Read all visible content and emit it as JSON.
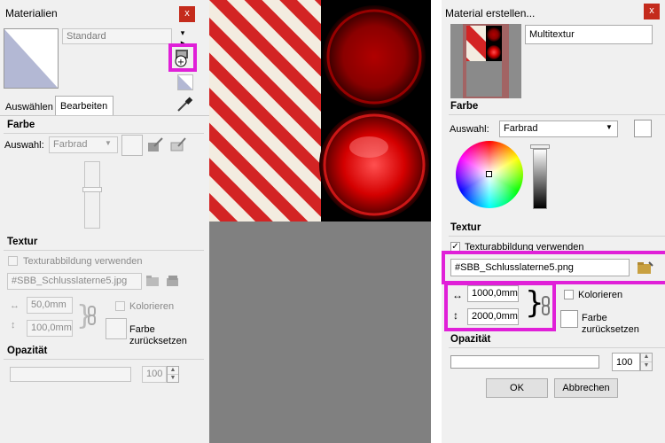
{
  "left_panel": {
    "title": "Materialien",
    "close": "x",
    "material_name": "Standard",
    "tabs": [
      "Auswählen",
      "Bearbeiten"
    ],
    "color_section": "Farbe",
    "color_select_label": "Auswahl:",
    "color_select_value": "Farbrad",
    "texture_section": "Textur",
    "use_texture_label": "Texturabbildung verwenden",
    "texture_file": "#SBB_Schlusslaterne5.jpg",
    "width_value": "50,0mm",
    "height_value": "100,0mm",
    "colorize_label": "Kolorieren",
    "reset_color_label_1": "Farbe",
    "reset_color_label_2": "zurücksetzen",
    "opacity_section": "Opazität",
    "opacity_value": "100"
  },
  "right_panel": {
    "title": "Material erstellen...",
    "close": "x",
    "material_name": "Multitextur",
    "color_section": "Farbe",
    "color_select_label": "Auswahl:",
    "color_select_value": "Farbrad",
    "texture_section": "Textur",
    "use_texture_label": "Texturabbildung verwenden",
    "texture_file": "#SBB_Schlusslaterne5.png",
    "width_value": "1000,0mm",
    "height_value": "2000,0mm",
    "colorize_label": "Kolorieren",
    "reset_color_label_1": "Farbe",
    "reset_color_label_2": "zurücksetzen",
    "opacity_section": "Opazität",
    "opacity_value": "100",
    "ok_button": "OK",
    "cancel_button": "Abbrechen"
  },
  "colors": {
    "highlight": "#e020d8",
    "stripe_red": "#d32424",
    "stripe_white": "#f3ece0",
    "lamp_red": "#e00000",
    "preview_gray": "#808080"
  }
}
